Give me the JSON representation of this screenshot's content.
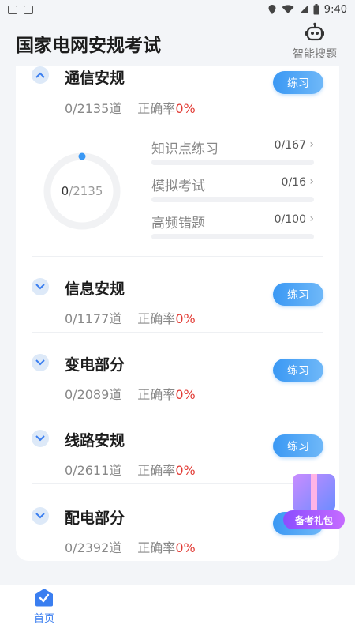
{
  "status_bar": {
    "time": "9:40"
  },
  "header": {
    "title": "国家电网安规考试",
    "search_label": "智能搜题"
  },
  "sections": [
    {
      "title": "通信安规",
      "stats": {
        "count_text": "0/2135道",
        "rate_label": "正确率",
        "rate_value": "0%"
      },
      "practice_label": "练习",
      "ring": {
        "done": "0",
        "total": "/2135",
        "progress": 0
      },
      "subitems": [
        {
          "label": "知识点练习",
          "count": "0/167",
          "progress": 0
        },
        {
          "label": "模拟考试",
          "count": "0/16",
          "progress": 0
        },
        {
          "label": "高频错题",
          "count": "0/100",
          "progress": 0
        }
      ]
    },
    {
      "title": "信息安规",
      "stats": {
        "count_text": "0/1177道",
        "rate_label": "正确率",
        "rate_value": "0%"
      },
      "practice_label": "练习"
    },
    {
      "title": "变电部分",
      "stats": {
        "count_text": "0/2089道",
        "rate_label": "正确率",
        "rate_value": "0%"
      },
      "practice_label": "练习"
    },
    {
      "title": "线路安规",
      "stats": {
        "count_text": "0/2611道",
        "rate_label": "正确率",
        "rate_value": "0%"
      },
      "practice_label": "练习"
    },
    {
      "title": "配电部分",
      "stats": {
        "count_text": "0/2392道",
        "rate_label": "正确率",
        "rate_value": "0%"
      },
      "practice_label": "练习"
    }
  ],
  "gift": {
    "label": "备考礼包"
  },
  "bottom_nav": {
    "home_label": "首页"
  },
  "colors": {
    "accent": "#3a98f4",
    "rate": "#e23b35"
  }
}
